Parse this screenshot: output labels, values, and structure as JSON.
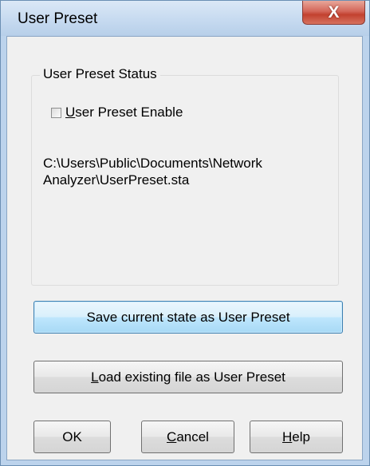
{
  "window": {
    "title": "User Preset",
    "close_glyph": "X"
  },
  "group": {
    "title": "User Preset Status",
    "checkbox": {
      "label_first": "U",
      "label_rest": "ser Preset Enable",
      "checked": false
    },
    "path_text": "C:\\Users\\Public\\Documents\\Network\nAnalyzer\\UserPreset.sta"
  },
  "buttons": {
    "save": "Save current state as User Preset",
    "load_first": "L",
    "load_rest": "oad existing file as User Preset",
    "ok": "OK",
    "cancel_first": "C",
    "cancel_rest": "ancel",
    "help_first": "H",
    "help_rest": "elp"
  },
  "icons": {
    "close": "close-icon",
    "checkbox": "checkbox-icon"
  }
}
